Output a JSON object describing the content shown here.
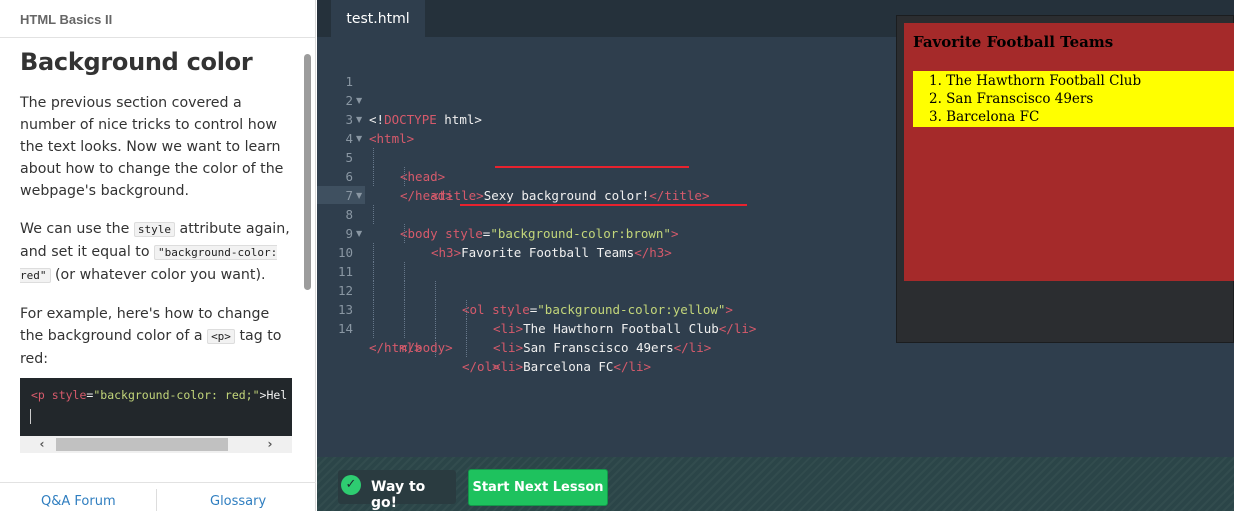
{
  "left_panel": {
    "header_title": "HTML Basics II",
    "lesson_title": "Background color",
    "para1": "The previous section covered a number of nice tricks to control how the text looks. Now we want to learn about how to change the color of the webpage's background.",
    "para2": {
      "a": "We can use the ",
      "code1": "style",
      "b": " attribute again, and set it equal to ",
      "code2": "\"background-color: red\"",
      "c": " (or whatever color you want)."
    },
    "para3": {
      "a": "For example, here's how to change the background color of a ",
      "code": "<p>",
      "b": " tag to red:"
    },
    "snippet": {
      "tag_open": "<p",
      "attr": " style",
      "eq": "=",
      "value": "\"background-color: red;\"",
      "rest": ">Hel"
    },
    "footer": {
      "qa_forum": "Q&A Forum",
      "glossary": "Glossary"
    }
  },
  "editor": {
    "tab_label": "test.html",
    "lines": {
      "l1": {
        "num": "1",
        "p1": "<!",
        "p2": "DOCTYPE",
        "p3": " html>"
      },
      "l2": {
        "num": "2",
        "tag": "<html>"
      },
      "l3": {
        "num": "3",
        "tag": "<head>"
      },
      "l4": {
        "num": "4",
        "open": "<title>",
        "text": "Sexy background color!",
        "close": "</title>"
      },
      "l5": {
        "num": "5",
        "tag": "</head>"
      },
      "l6": {
        "num": "6",
        "open": "<body",
        "attr": " style",
        "eq": "=",
        "value": "\"background-color:brown\"",
        "end": ">"
      },
      "l7": {
        "num": "7",
        "open": "<h3>",
        "text": "Favorite Football Teams",
        "close": "</h3>"
      },
      "l8": {
        "num": "8",
        "open": "<ol",
        "attr": " style",
        "eq": "=",
        "value": "\"background-color:yellow\"",
        "end": ">"
      },
      "l9": {
        "num": "9",
        "open": "<li>",
        "text": "The Hawthorn Football Club",
        "close": "</li>"
      },
      "l10": {
        "num": "10",
        "open": "<li>",
        "text": "San Franscisco 49ers",
        "close": "</li>"
      },
      "l11": {
        "num": "11",
        "open": "<li>",
        "text": "Barcelona FC",
        "close": "</li>"
      },
      "l12": {
        "num": "12",
        "tag": "</ol>"
      },
      "l13": {
        "num": "13",
        "tag": "</body>"
      },
      "l14": {
        "num": "14",
        "tag": "</html>"
      }
    }
  },
  "preview": {
    "title": "Favorite Football Teams",
    "items": [
      "1.  The Hawthorn Football Club",
      "2.  San Franscisco 49ers",
      "3.  Barcelona FC"
    ],
    "page_bg": "#a52a2a",
    "list_bg": "#ffff00"
  },
  "bottom_bar": {
    "success_label": "Way to go!",
    "next_button": "Start Next Lesson"
  },
  "colors": {
    "editor_bg": "#2f3e4d",
    "accent_green": "#1ec25e",
    "link_blue": "#2f7ec0",
    "annotation_red": "#e8222e"
  }
}
